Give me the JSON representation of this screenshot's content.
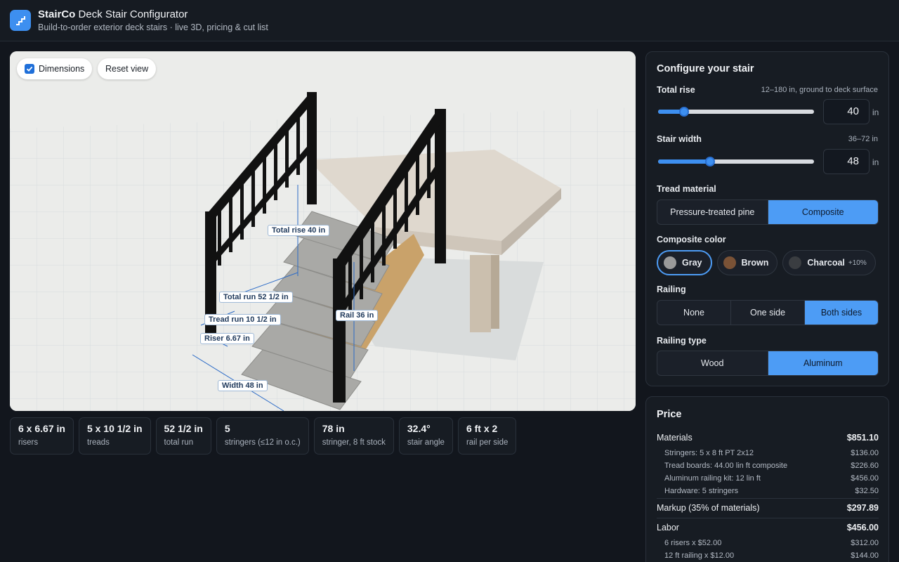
{
  "header": {
    "brand": "StairCo",
    "title": "Deck Stair Configurator",
    "subtitle": "Build-to-order exterior deck stairs · live 3D, pricing & cut list"
  },
  "viewport": {
    "dimensions_label": "Dimensions",
    "dimensions_checked": true,
    "reset_label": "Reset view",
    "dims": {
      "total_rise": "Total rise 40 in",
      "total_run": "Total run 52 1/2 in",
      "tread_run": "Tread run 10 1/2 in",
      "riser": "Riser 6.67 in",
      "width": "Width 48 in",
      "rail": "Rail 36 in"
    }
  },
  "stats": [
    {
      "value": "6 x 6.67 in",
      "label": "risers"
    },
    {
      "value": "5 x 10 1/2 in",
      "label": "treads"
    },
    {
      "value": "52 1/2 in",
      "label": "total run"
    },
    {
      "value": "5",
      "label": "stringers (≤12 in o.c.)"
    },
    {
      "value": "78 in",
      "label": "stringer, 8 ft stock"
    },
    {
      "value": "32.4°",
      "label": "stair angle"
    },
    {
      "value": "6 ft x 2",
      "label": "rail per side"
    }
  ],
  "config": {
    "title": "Configure your stair",
    "total_rise": {
      "label": "Total rise",
      "hint": "12–180 in, ground to deck surface",
      "value": "40",
      "unit": "in",
      "fraction": 0.1667
    },
    "stair_width": {
      "label": "Stair width",
      "hint": "36–72 in",
      "value": "48",
      "unit": "in",
      "fraction": 0.3333
    },
    "tread_material": {
      "label": "Tread material",
      "options": [
        "Pressure-treated pine",
        "Composite"
      ],
      "selected": 1
    },
    "composite_color": {
      "label": "Composite color",
      "options": [
        {
          "name": "Gray",
          "color": "#9a9a9a",
          "extra": ""
        },
        {
          "name": "Brown",
          "color": "#7a5236",
          "extra": ""
        },
        {
          "name": "Charcoal",
          "color": "#3a3d41",
          "extra": "+10%"
        }
      ],
      "selected": 0
    },
    "railing": {
      "label": "Railing",
      "options": [
        "None",
        "One side",
        "Both sides"
      ],
      "selected": 2
    },
    "railing_type": {
      "label": "Railing type",
      "options": [
        "Wood",
        "Aluminum"
      ],
      "selected": 1
    }
  },
  "price": {
    "title": "Price",
    "materials": {
      "label": "Materials",
      "amount": "$851.10"
    },
    "material_items": [
      {
        "label": "Stringers: 5 x 8 ft PT 2x12",
        "amount": "$136.00"
      },
      {
        "label": "Tread boards: 44.00 lin ft composite",
        "amount": "$226.60"
      },
      {
        "label": "Aluminum railing kit: 12 lin ft",
        "amount": "$456.00"
      },
      {
        "label": "Hardware: 5 stringers",
        "amount": "$32.50"
      }
    ],
    "markup": {
      "label": "Markup (35% of materials)",
      "amount": "$297.89"
    },
    "labor": {
      "label": "Labor",
      "amount": "$456.00"
    },
    "labor_items": [
      {
        "label": "6 risers x $52.00",
        "amount": "$312.00"
      },
      {
        "label": "12 ft railing x $12.00",
        "amount": "$144.00"
      }
    ]
  },
  "colors": {
    "accent": "#4d9cf5",
    "background": "#12161d",
    "panel": "#171c23"
  }
}
